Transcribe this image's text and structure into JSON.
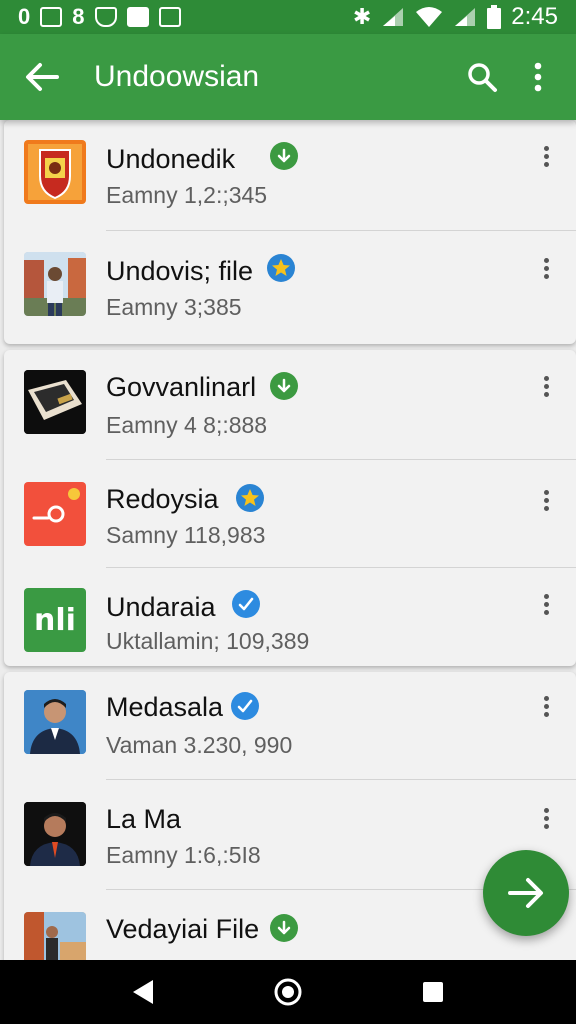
{
  "status": {
    "left": [
      "0",
      "8"
    ],
    "time": "2:45"
  },
  "appbar": {
    "title": "Undoowsian",
    "back_icon": "arrow-left-icon",
    "search_icon": "search-icon",
    "menu_icon": "more-vert-icon"
  },
  "items": [
    {
      "title": "Undonedik",
      "subtitle": "Eamny 1,2:;345",
      "badge": "check",
      "thumb": "emblem"
    },
    {
      "title": "Undovis; file",
      "subtitle": "Eamny 3;385",
      "badge": "star",
      "thumb": "person-street"
    },
    {
      "title": "Govvanlinarl",
      "subtitle": "Eamny 4 8;:888",
      "badge": "check",
      "thumb": "dark-object"
    },
    {
      "title": "Redoysia",
      "subtitle": "Samny 118,983",
      "badge": "star",
      "thumb": "orange-app"
    },
    {
      "title": "Undaraia",
      "subtitle": "Uktallamin; 109,389",
      "badge": "verified",
      "thumb": "green-app"
    },
    {
      "title": "Medasala",
      "subtitle": "Vaman 3.230, 990",
      "badge": "verified",
      "thumb": "portrait-suit"
    },
    {
      "title": "La Ma",
      "subtitle": "Eamny 1:6,:5I8",
      "badge": "none",
      "thumb": "portrait-dark"
    },
    {
      "title": "Vedayiai File",
      "subtitle": "",
      "badge": "check",
      "thumb": "person-outdoor"
    }
  ],
  "green_app_text": "nli",
  "colors": {
    "primary": "#3a9a43",
    "primary_dark": "#2e8b37",
    "check": "#3c9a41",
    "star_bg": "#2a84d3",
    "star": "#f6c21c",
    "verified": "#2d8be0",
    "fab": "#2f8b36"
  }
}
